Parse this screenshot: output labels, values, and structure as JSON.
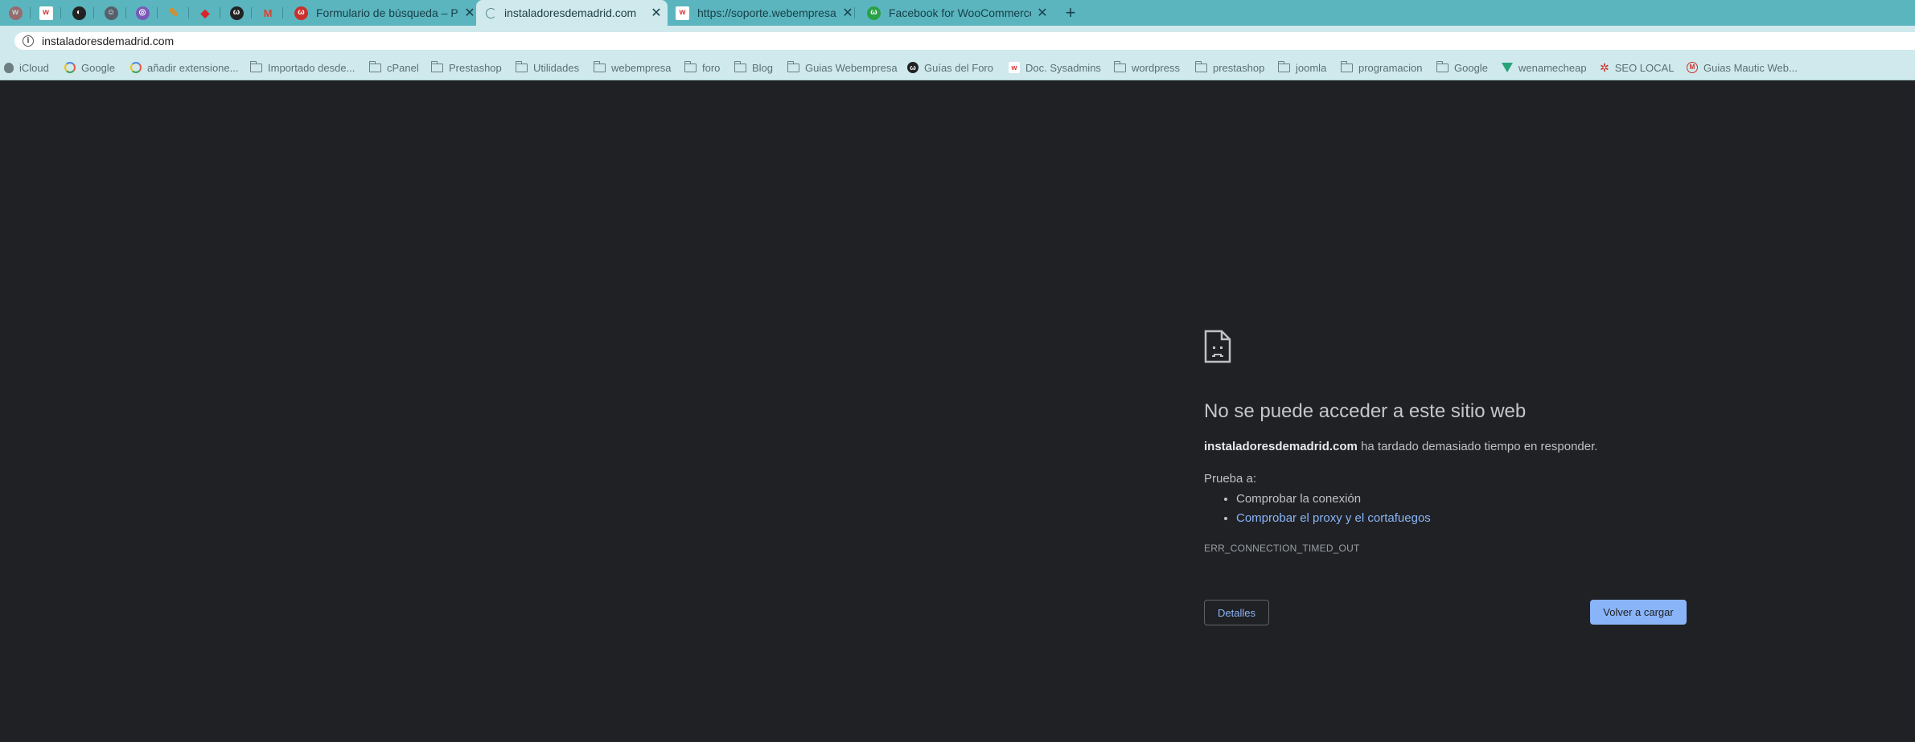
{
  "colors": {
    "tab_strip": "#5bb5be",
    "toolbar": "#cfe9ec",
    "page_background": "#202124",
    "link": "#8ab4f8",
    "primary_button": "#8ab4f8"
  },
  "tabs": {
    "pinned": [
      {
        "icon": "webempresa-icon",
        "color": "#c9302c",
        "letter": "w"
      },
      {
        "icon": "webempresa-w-icon",
        "color": "#d6332e",
        "letter": "w"
      },
      {
        "icon": "globe-icon",
        "color": "#222222",
        "letter": "◐"
      },
      {
        "icon": "robot-icon",
        "color": "#56606a",
        "letter": "☺"
      },
      {
        "icon": "target-icon",
        "color": "#7a5ab8",
        "letter": "◎"
      },
      {
        "icon": "pencil-icon",
        "color": "#e08a1e",
        "letter": "✎"
      },
      {
        "icon": "eraser-icon",
        "color": "#d8262c",
        "letter": "◆"
      },
      {
        "icon": "wordpress-forum-icon",
        "color": "#222222",
        "letter": "ω"
      },
      {
        "icon": "gmail-icon",
        "color": "#d44638",
        "letter": "M"
      }
    ],
    "items": [
      {
        "title": "Formulario de búsqueda – Plug",
        "icon": "webempresa-icon",
        "color": "#c9302c",
        "letter": "ω",
        "active": false
      },
      {
        "title": "instaladoresdemadrid.com",
        "icon": "loading-spinner-icon",
        "color": "#5b8a90",
        "letter": "",
        "active": true
      },
      {
        "title": "https://soporte.webempresa.c",
        "icon": "webempresa-w-icon",
        "color": "#d6332e",
        "letter": "w",
        "active": false
      },
      {
        "title": "Facebook for WooCommerce –",
        "icon": "wordpress-icon",
        "color": "#2aa146",
        "letter": "ω",
        "active": false
      }
    ],
    "close_glyph": "✕",
    "new_tab_glyph": "+"
  },
  "address_bar": {
    "url": "instaladoresdemadrid.com",
    "info_glyph": "i"
  },
  "bookmarks": [
    {
      "label": "iCloud",
      "icon": "apple-icon"
    },
    {
      "label": "Google",
      "icon": "google-icon"
    },
    {
      "label": "añadir extensione...",
      "icon": "google-icon"
    },
    {
      "label": "Importado desde...",
      "icon": "folder-icon"
    },
    {
      "label": "cPanel",
      "icon": "folder-icon"
    },
    {
      "label": "Prestashop",
      "icon": "folder-icon"
    },
    {
      "label": "Utilidades",
      "icon": "folder-icon"
    },
    {
      "label": "webempresa",
      "icon": "folder-icon"
    },
    {
      "label": "foro",
      "icon": "folder-icon"
    },
    {
      "label": "Blog",
      "icon": "folder-icon"
    },
    {
      "label": "Guias Webempresa",
      "icon": "folder-icon"
    },
    {
      "label": "Guías del Foro",
      "icon": "wordpress-forum-icon"
    },
    {
      "label": "Doc. Sysadmins",
      "icon": "webempresa-w-icon"
    },
    {
      "label": "wordpress",
      "icon": "folder-icon"
    },
    {
      "label": "prestashop",
      "icon": "folder-icon"
    },
    {
      "label": "joomla",
      "icon": "folder-icon"
    },
    {
      "label": "programacion",
      "icon": "folder-icon"
    },
    {
      "label": "Google",
      "icon": "folder-icon"
    },
    {
      "label": "wenamecheap",
      "icon": "vuetify-icon"
    },
    {
      "label": "SEO LOCAL",
      "icon": "settings-icon"
    },
    {
      "label": "Guias Mautic Web...",
      "icon": "mautic-icon"
    }
  ],
  "error_page": {
    "title": "No se puede acceder a este sitio web",
    "host": "instaladoresdemadrid.com",
    "description": " ha tardado demasiado tiempo en responder.",
    "try_label": "Prueba a:",
    "suggestions": [
      {
        "text": "Comprobar la conexión",
        "link": false
      },
      {
        "text": "Comprobar el proxy y el cortafuegos",
        "link": true
      }
    ],
    "error_code": "ERR_CONNECTION_TIMED_OUT",
    "details_button": "Detalles",
    "reload_button": "Volver a cargar"
  }
}
